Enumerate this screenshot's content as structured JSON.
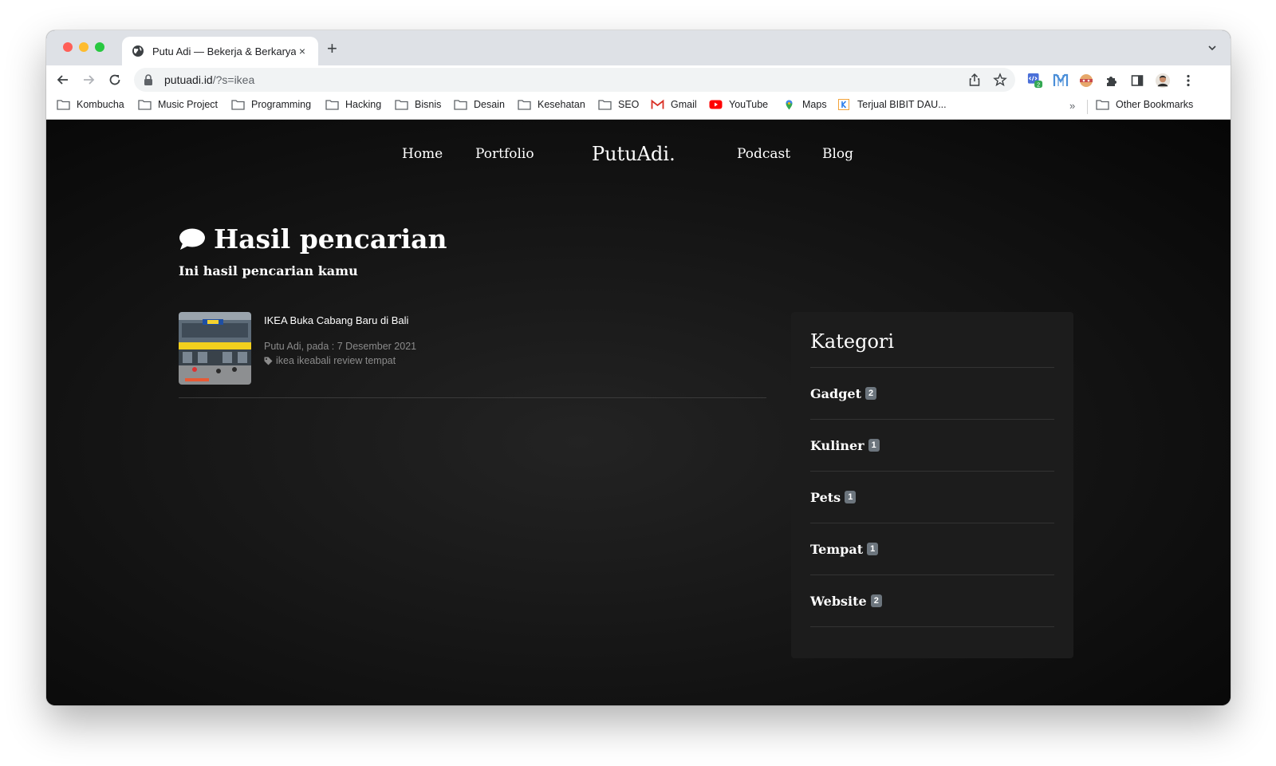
{
  "browser": {
    "tab_title": "Putu Adi — Bekerja & Berkarya",
    "tab_close": "×",
    "new_tab": "+",
    "url_host": "putuadi.id",
    "url_path": "/?s=ikea",
    "extension_badge": "2",
    "bookmarks": [
      {
        "label": "Kombucha",
        "icon": "folder-icon"
      },
      {
        "label": "Music Project",
        "icon": "folder-icon"
      },
      {
        "label": "Programming",
        "icon": "folder-icon"
      },
      {
        "label": "Hacking",
        "icon": "folder-icon"
      },
      {
        "label": "Bisnis",
        "icon": "folder-icon"
      },
      {
        "label": "Desain",
        "icon": "folder-icon"
      },
      {
        "label": "Kesehatan",
        "icon": "folder-icon"
      },
      {
        "label": "SEO",
        "icon": "folder-icon"
      },
      {
        "label": "Gmail",
        "icon": "gmail-icon"
      },
      {
        "label": "YouTube",
        "icon": "youtube-icon"
      },
      {
        "label": "Maps",
        "icon": "maps-icon"
      },
      {
        "label": "Terjual BIBIT DAU...",
        "icon": "kasir-icon"
      }
    ],
    "bookmarks_more": "»",
    "other_bookmarks": "Other Bookmarks"
  },
  "site": {
    "nav": {
      "home": "Home",
      "portfolio": "Portfolio",
      "brand": "PutuAdi.",
      "podcast": "Podcast",
      "blog": "Blog"
    },
    "heading": "Hasil pencarian",
    "subtitle": "Ini hasil pencarian kamu",
    "results": [
      {
        "title": "IKEA Buka Cabang Baru di Bali",
        "meta": "Putu Adi, pada : 7 Desember 2021",
        "tags": "ikea ikeabali review tempat"
      }
    ],
    "sidebar": {
      "title": "Kategori",
      "categories": [
        {
          "name": "Gadget",
          "count": "2"
        },
        {
          "name": "Kuliner",
          "count": "1"
        },
        {
          "name": "Pets",
          "count": "1"
        },
        {
          "name": "Tempat",
          "count": "1"
        },
        {
          "name": "Website",
          "count": "2"
        }
      ]
    }
  },
  "colors": {
    "page_bg": "#0b0b0b",
    "sidebar_bg": "#1c1c1c",
    "badge_bg": "#6c757d",
    "meta_text": "#8b8b8b"
  }
}
